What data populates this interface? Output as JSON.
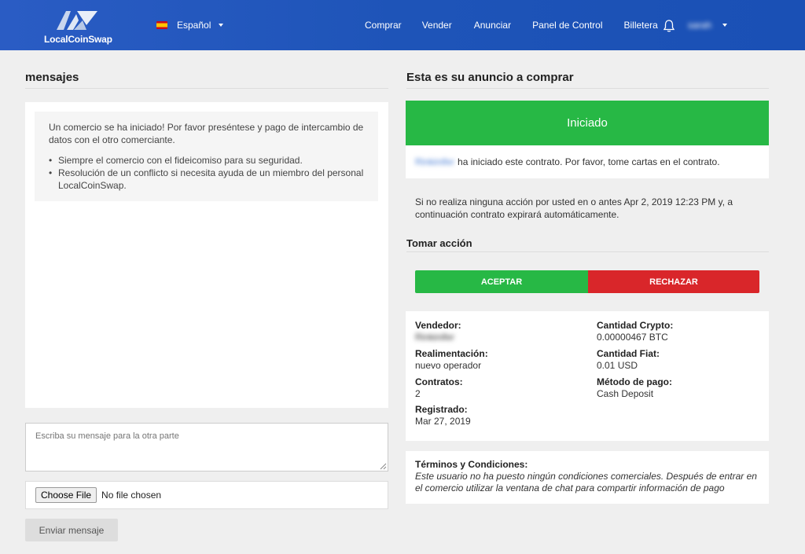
{
  "header": {
    "brand": "LocalCoinSwap",
    "language": "Español",
    "nav": [
      "Comprar",
      "Vender",
      "Anunciar",
      "Panel de Control",
      "Billetera"
    ],
    "username": "sarah"
  },
  "left": {
    "heading": "mensajes",
    "notice_intro": "Un comercio se ha iniciado! Por favor preséntese y pago de intercambio de datos con el otro comerciante.",
    "notice_items": [
      "Siempre el comercio con el fideicomiso para su seguridad.",
      "Resolución de un conflicto si necesita ayuda de un miembro del personal LocalCoinSwap."
    ],
    "message_placeholder": "Escriba su mensaje para la otra parte",
    "file_button": "Choose File",
    "file_status": "No file chosen",
    "send_label": "Enviar mensaje"
  },
  "right": {
    "heading": "Esta es su anuncio a comprar",
    "status": "Iniciado",
    "started_user": "Rinkinifer",
    "started_text": "ha iniciado este contrato. Por favor, tome cartas en el contrato.",
    "expiry": "Si no realiza ninguna acción por usted en o antes Apr 2, 2019 12:23 PM y, a continuación contrato expirará automáticamente.",
    "action_heading": "Tomar acción",
    "accept_label": "ACEPTAR",
    "reject_label": "RECHAZAR",
    "details": {
      "seller_label": "Vendedor:",
      "seller_value": "Rinkinifer",
      "feedback_label": "Realimentación:",
      "feedback_value": "nuevo operador",
      "contracts_label": "Contratos:",
      "contracts_value": "2",
      "registered_label": "Registrado:",
      "registered_value": "Mar 27, 2019",
      "crypto_label": "Cantidad Crypto:",
      "crypto_value": "0.00000467 BTC",
      "fiat_label": "Cantidad Fiat:",
      "fiat_value": "0.01 USD",
      "method_label": "Método de pago:",
      "method_value": "Cash Deposit"
    },
    "terms_label": "Términos y Condiciones:",
    "terms_text": "Este usuario no ha puesto ningún condiciones comerciales. Después de entrar en el comercio utilizar la ventana de chat para compartir información de pago"
  },
  "colors": {
    "header": "#1e54b8",
    "success": "#27b845",
    "danger": "#d9262a",
    "link": "#4a7fd6"
  }
}
